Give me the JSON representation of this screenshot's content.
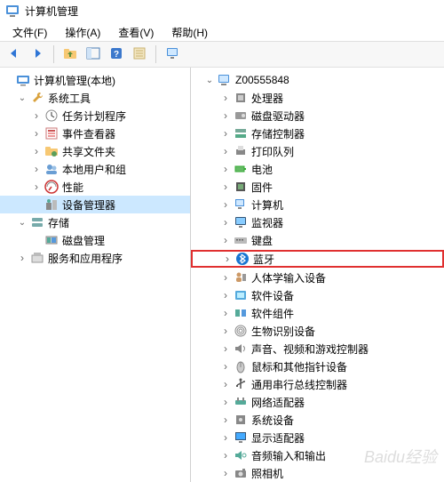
{
  "window": {
    "title": "计算机管理"
  },
  "menu": {
    "file": "文件(F)",
    "action": "操作(A)",
    "view": "查看(V)",
    "help": "帮助(H)"
  },
  "left_tree": {
    "root": {
      "label": "计算机管理(本地)"
    },
    "system_tools": {
      "label": "系统工具"
    },
    "task_scheduler": {
      "label": "任务计划程序"
    },
    "event_viewer": {
      "label": "事件查看器"
    },
    "shared_folders": {
      "label": "共享文件夹"
    },
    "local_users": {
      "label": "本地用户和组"
    },
    "performance": {
      "label": "性能"
    },
    "device_manager": {
      "label": "设备管理器"
    },
    "storage": {
      "label": "存储"
    },
    "disk_mgmt": {
      "label": "磁盘管理"
    },
    "services_apps": {
      "label": "服务和应用程序"
    }
  },
  "right_tree": {
    "computer": {
      "label": "Z00555848"
    },
    "items": [
      {
        "label": "处理器",
        "icon": "cpu"
      },
      {
        "label": "磁盘驱动器",
        "icon": "disk"
      },
      {
        "label": "存储控制器",
        "icon": "storage-ctrl"
      },
      {
        "label": "打印队列",
        "icon": "printer"
      },
      {
        "label": "电池",
        "icon": "battery"
      },
      {
        "label": "固件",
        "icon": "firmware"
      },
      {
        "label": "计算机",
        "icon": "pc"
      },
      {
        "label": "监视器",
        "icon": "monitor"
      },
      {
        "label": "键盘",
        "icon": "keyboard"
      },
      {
        "label": "蓝牙",
        "icon": "bluetooth",
        "highlighted": true
      },
      {
        "label": "人体学输入设备",
        "icon": "hid"
      },
      {
        "label": "软件设备",
        "icon": "soft-dev"
      },
      {
        "label": "软件组件",
        "icon": "soft-comp"
      },
      {
        "label": "生物识别设备",
        "icon": "biometric"
      },
      {
        "label": "声音、视频和游戏控制器",
        "icon": "sound"
      },
      {
        "label": "鼠标和其他指针设备",
        "icon": "mouse"
      },
      {
        "label": "通用串行总线控制器",
        "icon": "usb"
      },
      {
        "label": "网络适配器",
        "icon": "network"
      },
      {
        "label": "系统设备",
        "icon": "system"
      },
      {
        "label": "显示适配器",
        "icon": "display"
      },
      {
        "label": "音频输入和输出",
        "icon": "audio-io"
      },
      {
        "label": "照相机",
        "icon": "camera"
      }
    ]
  },
  "watermark": "Baidu经验"
}
